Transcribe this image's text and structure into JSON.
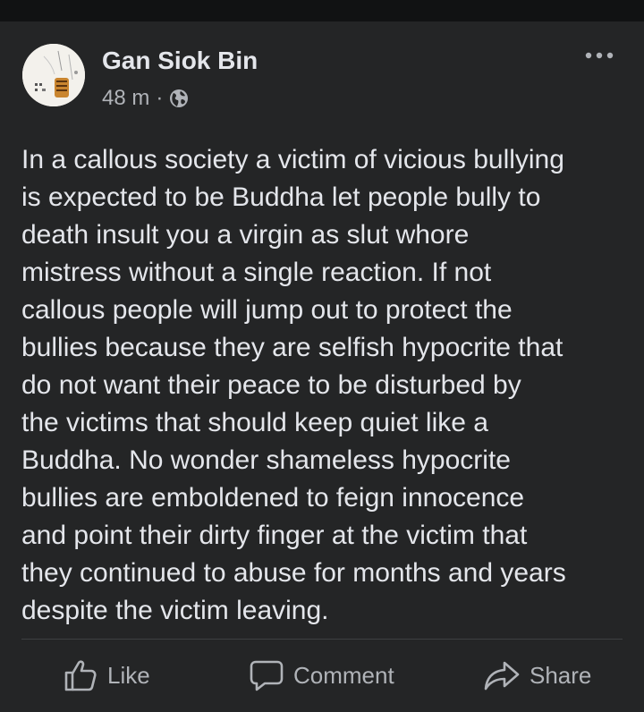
{
  "post": {
    "author": "Gan Siok Bin",
    "time": "48 m",
    "separator": "·",
    "audience_icon": "globe-icon",
    "menu_icon": "more-dots-icon",
    "text": "In a callous society a victim of vicious bullying\nis expected to be Buddha let people bully to\ndeath insult you a virgin as slut whore\nmistress without a single reaction. If not\ncallous people will jump out to protect the\nbullies because they are selfish hypocrite that\ndo not want their peace to be disturbed by\nthe victims that should keep quiet like a\nBuddha. No wonder shameless hypocrite\nbullies are emboldened to feign innocence\nand point their dirty finger at the victim that\nthey continued to abuse for months and years\ndespite the victim leaving."
  },
  "actions": {
    "like_label": "Like",
    "comment_label": "Comment",
    "share_label": "Share"
  },
  "colors": {
    "background": "#18191a",
    "card": "#242526",
    "primary_text": "#e4e6eb",
    "secondary_text": "#b0b3b8",
    "divider": "#3e4042"
  }
}
